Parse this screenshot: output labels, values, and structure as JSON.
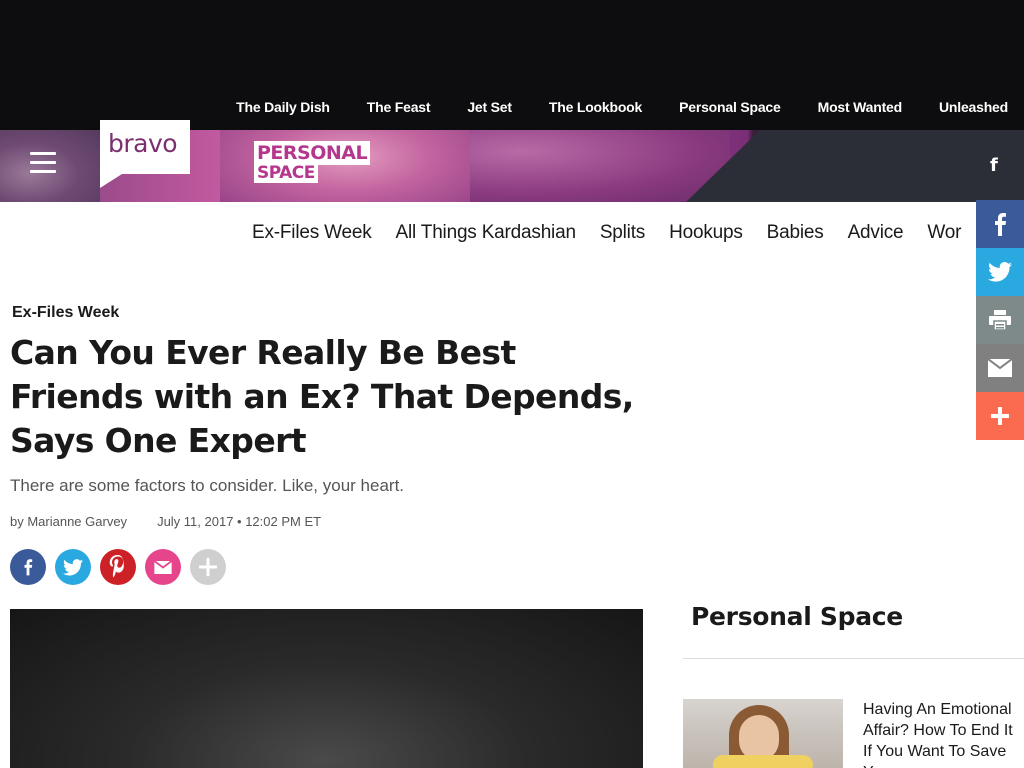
{
  "site_nav": [
    "The Daily Dish",
    "The Feast",
    "Jet Set",
    "The Lookbook",
    "Personal Space",
    "Most Wanted",
    "Unleashed"
  ],
  "brand": {
    "logo_text": "bravo",
    "section_logo_line1": "PERSONAL",
    "section_logo_line2": "SPACE",
    "social_glyph": "f"
  },
  "category_nav": [
    "Ex-Files Week",
    "All Things Kardashian",
    "Splits",
    "Hookups",
    "Babies",
    "Advice",
    "Wor"
  ],
  "share_rail": [
    "facebook-icon",
    "twitter-icon",
    "print-icon",
    "email-icon",
    "plus-icon"
  ],
  "article": {
    "kicker": "Ex-Files Week",
    "title": "Can You Ever Really Be Best Friends with an Ex? That Depends, Says One Expert",
    "dek": "There are some factors to consider. Like, your heart.",
    "byline": "by Marianne Garvey",
    "date": "July 11, 2017 • 12:02 PM ET"
  },
  "share_buttons": [
    "facebook-icon",
    "twitter-icon",
    "pinterest-icon",
    "email-icon",
    "plus-icon"
  ],
  "sidebar": {
    "title": "Personal Space",
    "item_title": "Having An Emotional Affair? How To End It If You Want To Save Y..."
  },
  "colors": {
    "facebook": "#3b5a9a",
    "twitter": "#2aa9e0",
    "pinterest": "#cc2127",
    "email": "#e6458c",
    "plus": "#fb6b50",
    "brand_purple": "#7b2f6e"
  }
}
